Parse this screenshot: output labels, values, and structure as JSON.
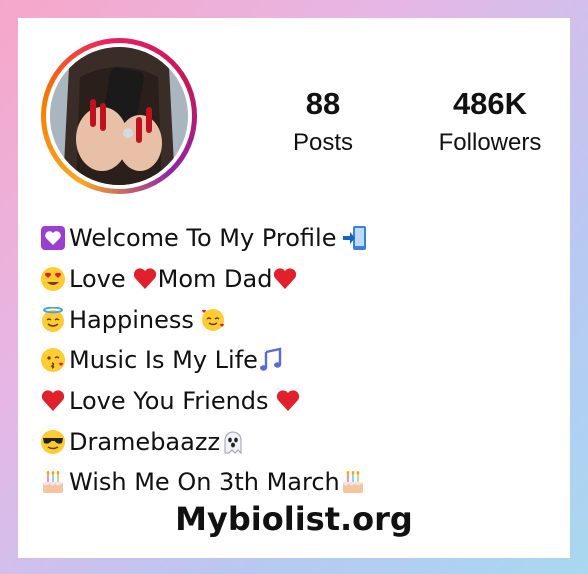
{
  "profile": {
    "stats": {
      "posts": {
        "value": "88",
        "label": "Posts"
      },
      "followers": {
        "value": "486K",
        "label": "Followers"
      }
    },
    "bio": [
      {
        "lead": "purple-heart-icon",
        "text": "Welcome To My Profile",
        "trail": "mobile-arrow-icon"
      },
      {
        "lead": "heart-eyes-icon",
        "text": "Love",
        "mid": "red-heart-icon",
        "text2": "Mom Dad",
        "trail": "red-heart-icon"
      },
      {
        "lead": "halo-face-icon",
        "text": "Happiness",
        "trail": "smiling-hearts-face-icon"
      },
      {
        "lead": "kissing-face-icon",
        "text": "Music Is My Life",
        "trail": "music-notes-icon"
      },
      {
        "lead": "red-heart-icon",
        "text": "Love You Friends",
        "trail": "red-heart-icon"
      },
      {
        "lead": "sunglasses-face-icon",
        "text": "Dramebaazz",
        "trail": "ghost-icon"
      },
      {
        "lead": "birthday-cake-icon",
        "text": "Wish Me On 3th March",
        "trail": "birthday-cake-icon"
      }
    ]
  },
  "footer": {
    "site": "Mybiolist.org"
  },
  "colors": {
    "ring_orange": "#f57c00",
    "ring_pink": "#e91e63",
    "ring_purple": "#8e24aa",
    "heart_red": "#e0202b"
  }
}
